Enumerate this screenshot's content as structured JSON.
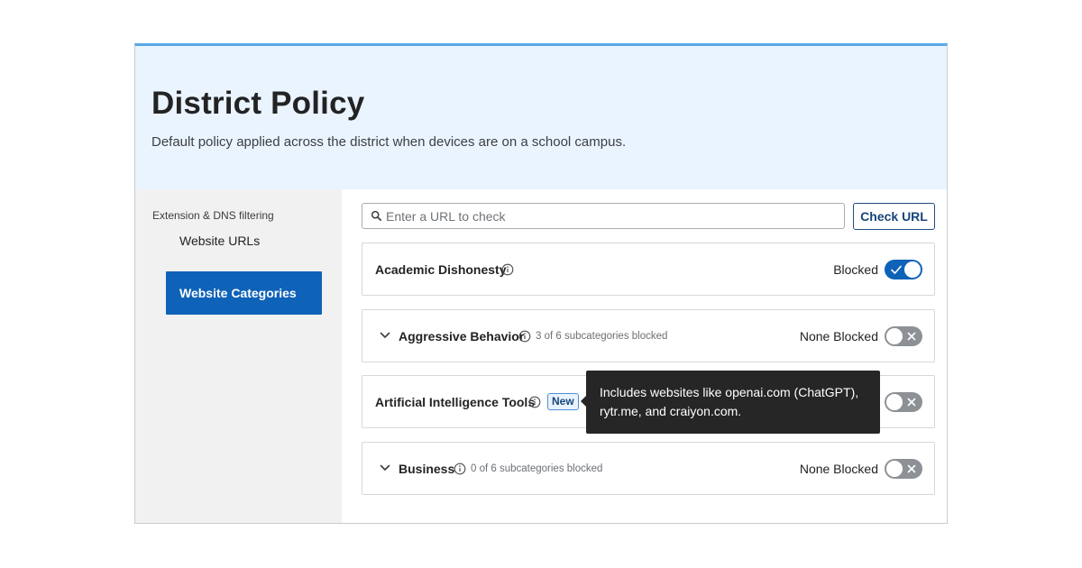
{
  "page": {
    "title": "District Policy",
    "subtitle": "Default policy applied across the district when devices are on a school campus."
  },
  "sidebar": {
    "section_label": "Extension & DNS filtering",
    "items": [
      {
        "label": "Website URLs",
        "active": false
      },
      {
        "label": "Website Categories",
        "active": true
      }
    ]
  },
  "search": {
    "placeholder": "Enter a URL to check",
    "value": "",
    "icon": "search-icon",
    "button_label": "Check URL"
  },
  "categories": [
    {
      "name": "Academic Dishonesty",
      "subcategories": "",
      "status": "Blocked",
      "toggle": "on",
      "expandable": false,
      "badge": ""
    },
    {
      "name": "Aggressive Behavior",
      "subcategories": "3 of 6 subcategories blocked",
      "status": "None Blocked",
      "toggle": "off",
      "expandable": true,
      "badge": ""
    },
    {
      "name": "Artificial Intelligence Tools",
      "subcategories": "",
      "status": "",
      "toggle": "off",
      "expandable": false,
      "badge": "New"
    },
    {
      "name": "Business",
      "subcategories": "0 of 6 subcategories blocked",
      "status": "None Blocked",
      "toggle": "off",
      "expandable": true,
      "badge": ""
    }
  ],
  "tooltip": {
    "text": "Includes websites like openai.com (ChatGPT), rytr.me, and craiyon.com."
  },
  "colors": {
    "accent": "#0e62b8",
    "header_bg": "#eaf4ff",
    "header_top_border": "#5aa9e6",
    "sidebar_bg": "#f1f1f1",
    "toggle_off": "#8d9196",
    "tooltip_bg": "#262626"
  }
}
